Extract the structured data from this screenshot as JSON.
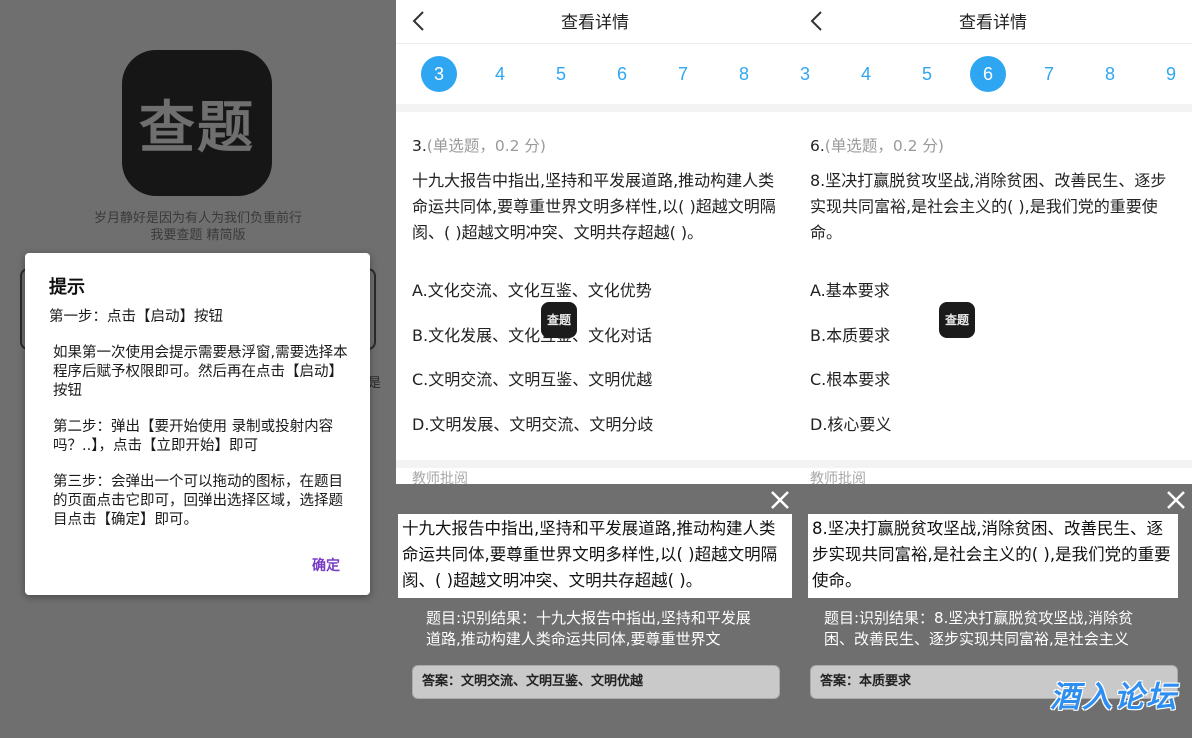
{
  "panel1": {
    "logo_text": "查题",
    "slogan": [
      "岁月静好是因为有人为我们负重前行",
      "我要查题 精简版"
    ],
    "bg_fragment": "是",
    "dialog": {
      "title": "提示",
      "paragraphs": [
        "第一步：点击【启动】按钮",
        "如果第一次使用会提示需要悬浮窗,需要选择本程序后赋予权限即可。然后再在点击【启动】按钮",
        "第二步：弹出【要开始使用 录制或投射内容吗？..】，点击【立即开始】即可",
        "第三步：会弹出一个可以拖动的图标，在题目的页面点击它即可，回弹出选择区域，选择题目点击【确定】即可。"
      ],
      "ok_label": "确定"
    }
  },
  "detail_left": {
    "title": "查看详情",
    "numbers": [
      "3",
      "4",
      "5",
      "6",
      "7",
      "8"
    ],
    "active_number": "3",
    "question_number": "3.",
    "question_type": "(单选题，0.2 分)",
    "question_text": "十九大报告中指出,坚持和平发展道路,推动构建人类命运共同体,要尊重世界文明多样性,以( )超越文明隔阂、( )超越文明冲突、文明共存超越( )。",
    "options": [
      "A.文化交流、文化互鉴、文化优势",
      "B.文化发展、文化互鉴、文化对话",
      "C.文明交流、文明互鉴、文明优越",
      "D.文明发展、文明交流、文明分歧"
    ],
    "float_icon_text": "查题",
    "teacher_label": "教师批阅",
    "selection_text": "十九大报告中指出,坚持和平发展道路,推动构建人类命运共同体,要尊重世界文明多样性,以( )超越文明隔阂、( )超越文明冲突、文明共存超越( )。",
    "result_text": "题目:识别结果：十九大报告中指出,坚持和平发展道路,推动构建人类命运共同体,要尊重世界文",
    "answer_text": "答案：文明交流、文明互鉴、文明优越"
  },
  "detail_right": {
    "title": "查看详情",
    "numbers": [
      "3",
      "4",
      "5",
      "6",
      "7",
      "8",
      "9"
    ],
    "active_number": "6",
    "question_number": "6.",
    "question_type": "(单选题，0.2 分)",
    "question_text": "8.坚决打赢脱贫攻坚战,消除贫困、改善民生、逐步实现共同富裕,是社会主义的( ),是我们党的重要使命。",
    "options": [
      "A.基本要求",
      "B.本质要求",
      "C.根本要求",
      "D.核心要义"
    ],
    "float_icon_text": "查题",
    "teacher_label": "教师批阅",
    "selection_text": "8.坚决打赢脱贫攻坚战,消除贫困、改善民生、逐步实现共同富裕,是社会主义的( ),是我们党的重要使命。",
    "result_text": "题目:识别结果：8.坚决打赢脱贫攻坚战,消除贫困、改善民生、逐步实现共同富裕,是社会主义",
    "answer_text": "答案：本质要求"
  },
  "watermark": "酒入论坛",
  "colors": {
    "accent_blue": "#2fa6f2",
    "confirm_purple": "#7a3cc7",
    "overlay_gray": "#6f6f6f",
    "answer_box": "#c9c9c9",
    "watermark_blue": "#2f8ff0"
  }
}
